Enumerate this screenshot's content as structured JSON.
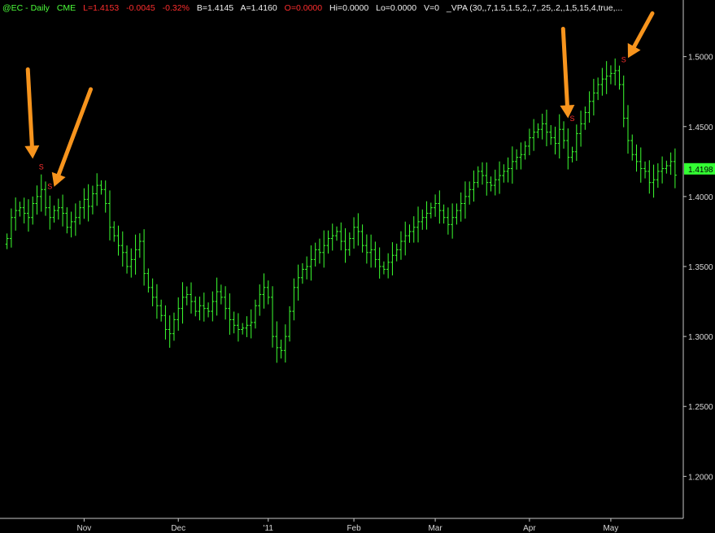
{
  "header": {
    "symbol": "@EC - Daily",
    "exchange": "CME",
    "last": "L=1.4153",
    "change": "-0.0045",
    "change_pct": "-0.32%",
    "bid": "B=1.4145",
    "ask": "A=1.4160",
    "open": "O=0.0000",
    "high": "Hi=0.0000",
    "low": "Lo=0.0000",
    "volume": "V=0",
    "indicator": "_VPA (30,,7,1.5,1.5,2,,7,.25,.2,,1,5,15,4,true,..."
  },
  "colors": {
    "background": "#000000",
    "bars": "#3cff30",
    "axis": "#c8c8c8",
    "last_price_bg": "#33ff33",
    "signal": "#ff3030",
    "arrow": "#f7941d"
  },
  "last_price_label": "1.4198",
  "chart_data": {
    "type": "ohlc",
    "title": "",
    "ylim": [
      1.17,
      1.53
    ],
    "y_ticks": [
      "1.2000",
      "1.2500",
      "1.3000",
      "1.3500",
      "1.4000",
      "1.4500",
      "1.5000"
    ],
    "x_ticks": [
      {
        "label": "Nov",
        "bar": 18
      },
      {
        "label": "Dec",
        "bar": 40
      },
      {
        "label": "'11",
        "bar": 61
      },
      {
        "label": "Feb",
        "bar": 81
      },
      {
        "label": "Mar",
        "bar": 100
      },
      {
        "label": "Apr",
        "bar": 122
      },
      {
        "label": "May",
        "bar": 141
      }
    ],
    "signals": [
      {
        "label": "S",
        "bar": 8,
        "price": 1.4195
      },
      {
        "label": "S",
        "bar": 10,
        "price": 1.4055
      },
      {
        "label": "S",
        "bar": 132,
        "price": 1.454
      },
      {
        "label": "S",
        "bar": 144,
        "price": 1.496
      }
    ],
    "arrows": [
      {
        "bar": 6,
        "price_tip": 1.427,
        "direction": "down"
      },
      {
        "bar": 11,
        "price_tip": 1.407,
        "direction": "down-left"
      },
      {
        "bar": 131,
        "price_tip": 1.456,
        "direction": "down"
      },
      {
        "bar": 145,
        "price_tip": 1.499,
        "direction": "down-left"
      }
    ],
    "x_bars": 155,
    "close": [
      1.37,
      1.385,
      1.39,
      1.392,
      1.388,
      1.385,
      1.395,
      1.4,
      1.405,
      1.392,
      1.385,
      1.39,
      1.392,
      1.388,
      1.378,
      1.382,
      1.385,
      1.392,
      1.398,
      1.393,
      1.402,
      1.408,
      1.405,
      1.395,
      1.378,
      1.372,
      1.365,
      1.36,
      1.35,
      1.355,
      1.362,
      1.368,
      1.345,
      1.335,
      1.328,
      1.322,
      1.315,
      1.305,
      1.302,
      1.312,
      1.32,
      1.328,
      1.33,
      1.325,
      1.318,
      1.322,
      1.32,
      1.318,
      1.325,
      1.332,
      1.328,
      1.32,
      1.312,
      1.308,
      1.305,
      1.306,
      1.308,
      1.31,
      1.322,
      1.33,
      1.335,
      1.328,
      1.3,
      1.292,
      1.29,
      1.3,
      1.318,
      1.335,
      1.342,
      1.348,
      1.35,
      1.355,
      1.362,
      1.36,
      1.365,
      1.37,
      1.372,
      1.375,
      1.368,
      1.362,
      1.37,
      1.378,
      1.375,
      1.365,
      1.36,
      1.362,
      1.355,
      1.35,
      1.348,
      1.353,
      1.358,
      1.362,
      1.368,
      1.372,
      1.375,
      1.378,
      1.382,
      1.385,
      1.388,
      1.392,
      1.395,
      1.39,
      1.385,
      1.38,
      1.385,
      1.39,
      1.395,
      1.4,
      1.405,
      1.41,
      1.418,
      1.415,
      1.41,
      1.408,
      1.412,
      1.415,
      1.418,
      1.42,
      1.425,
      1.428,
      1.43,
      1.436,
      1.442,
      1.446,
      1.448,
      1.452,
      1.446,
      1.442,
      1.438,
      1.448,
      1.44,
      1.428,
      1.432,
      1.445,
      1.452,
      1.46,
      1.468,
      1.474,
      1.48,
      1.484,
      1.486,
      1.488,
      1.49,
      1.48,
      1.456,
      1.44,
      1.43,
      1.425,
      1.42,
      1.418,
      1.41,
      1.412,
      1.418,
      1.42,
      1.422,
      1.425,
      1.4153
    ]
  }
}
